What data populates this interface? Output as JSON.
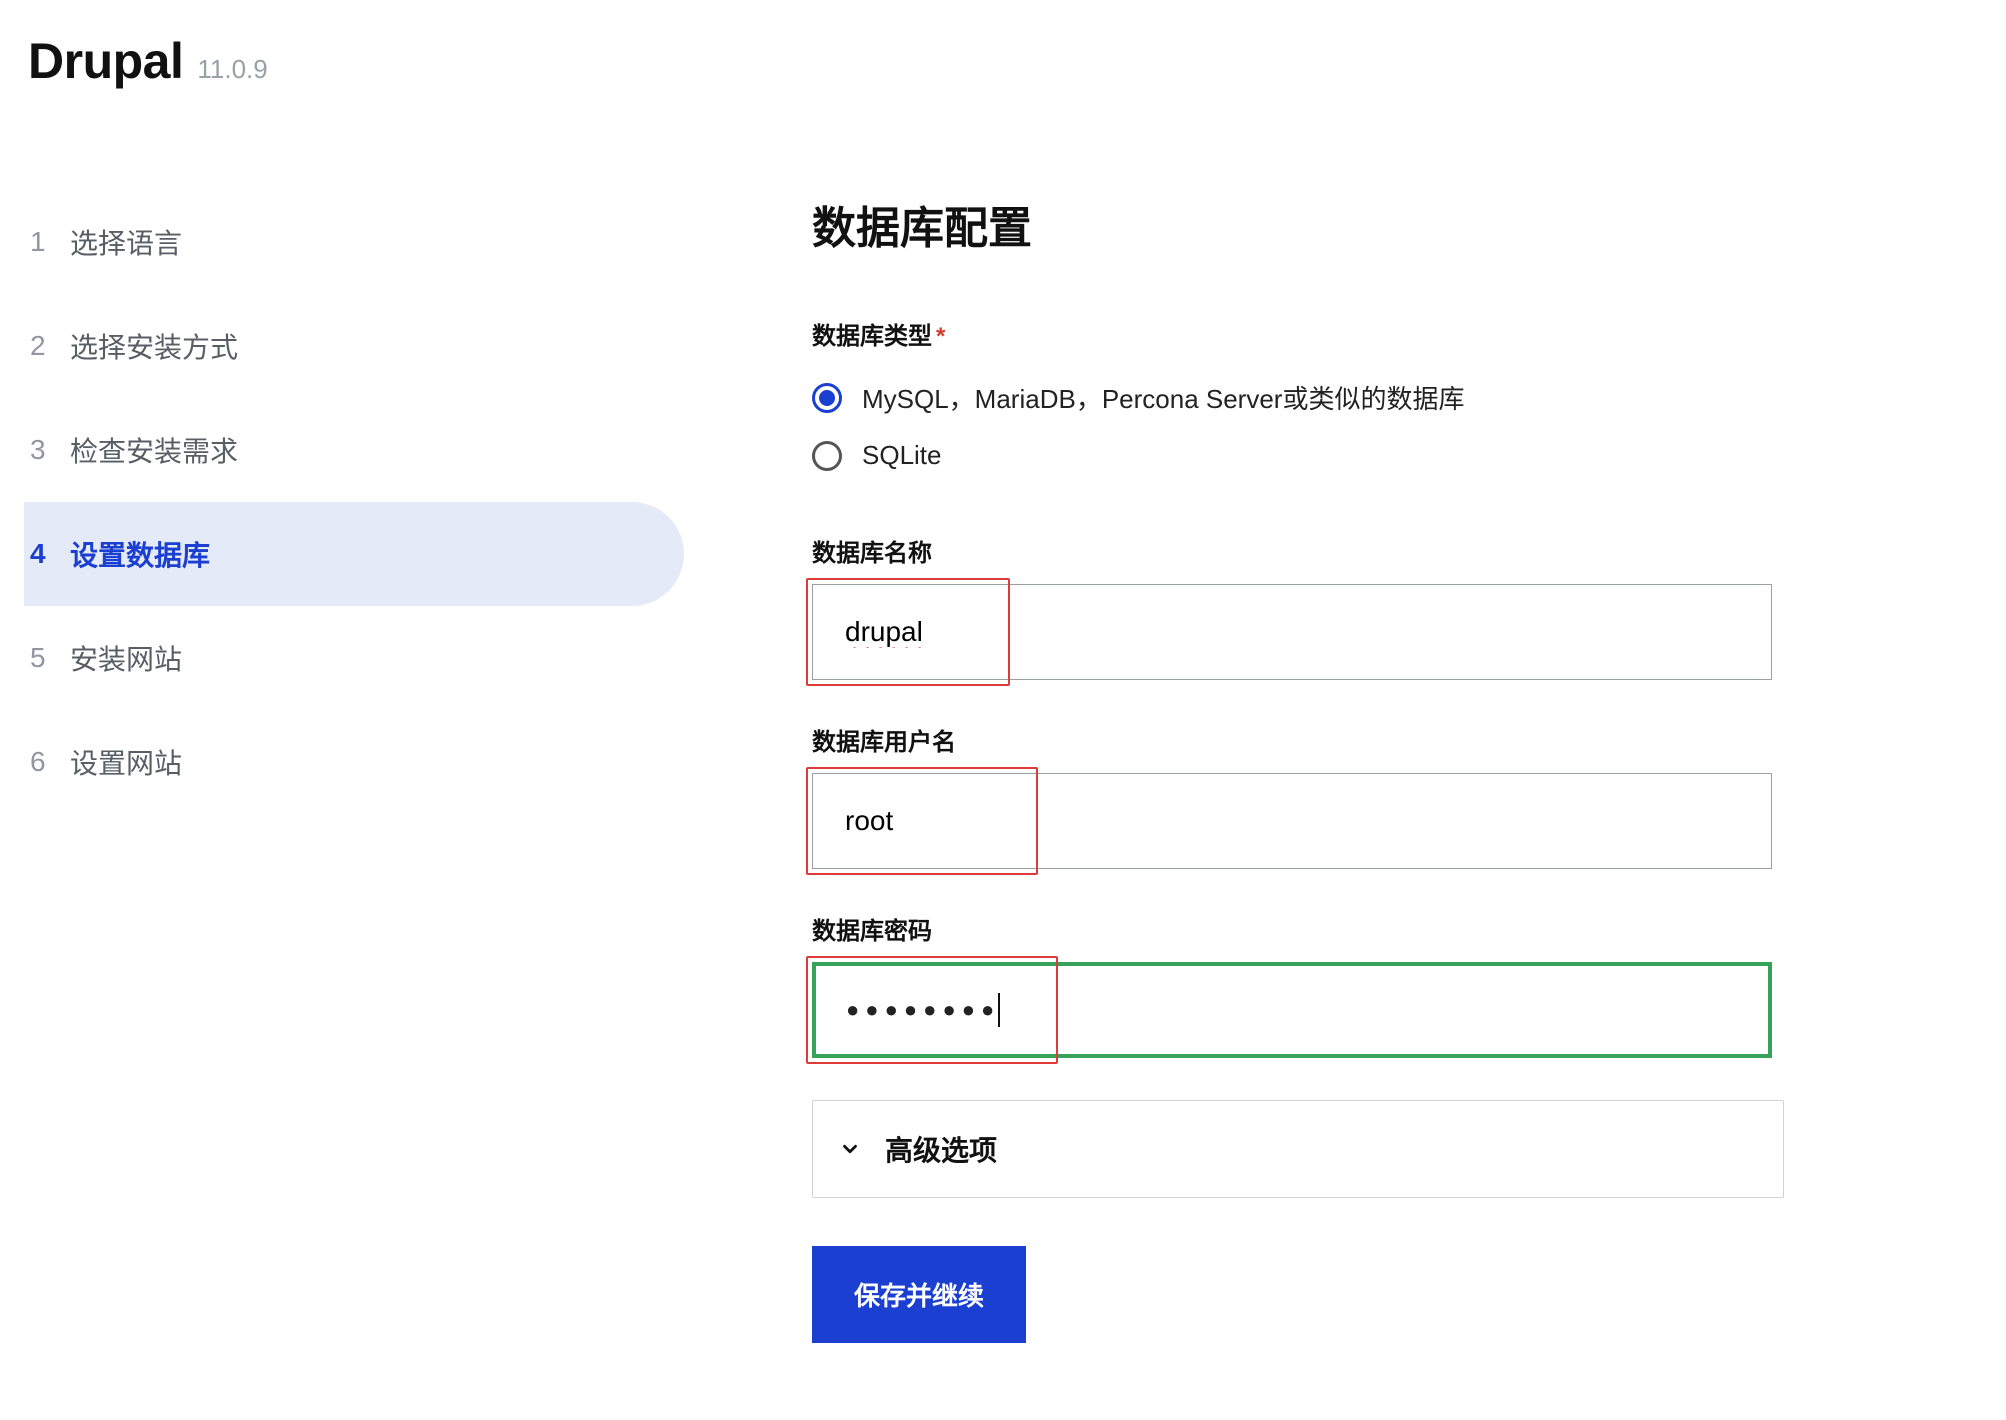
{
  "brand": {
    "name": "Drupal",
    "version": "11.0.9"
  },
  "steps": [
    {
      "num": "1",
      "label": "选择语言",
      "active": false
    },
    {
      "num": "2",
      "label": "选择安装方式",
      "active": false
    },
    {
      "num": "3",
      "label": "检查安装需求",
      "active": false
    },
    {
      "num": "4",
      "label": "设置数据库",
      "active": true
    },
    {
      "num": "5",
      "label": "安装网站",
      "active": false
    },
    {
      "num": "6",
      "label": "设置网站",
      "active": false
    }
  ],
  "main": {
    "title": "数据库配置",
    "db_type": {
      "label": "数据库类型",
      "required_marker": "*",
      "options": [
        {
          "label": "MySQL，MariaDB，Percona Server或类似的数据库",
          "checked": true
        },
        {
          "label": "SQLite",
          "checked": false
        }
      ]
    },
    "db_name": {
      "label": "数据库名称",
      "value": "drupal"
    },
    "db_user": {
      "label": "数据库用户名",
      "value": "root"
    },
    "db_pass": {
      "label": "数据库密码",
      "masked_value": "●●●●●●●●"
    },
    "advanced": {
      "label": "高级选项"
    },
    "submit_label": "保存并继续"
  }
}
